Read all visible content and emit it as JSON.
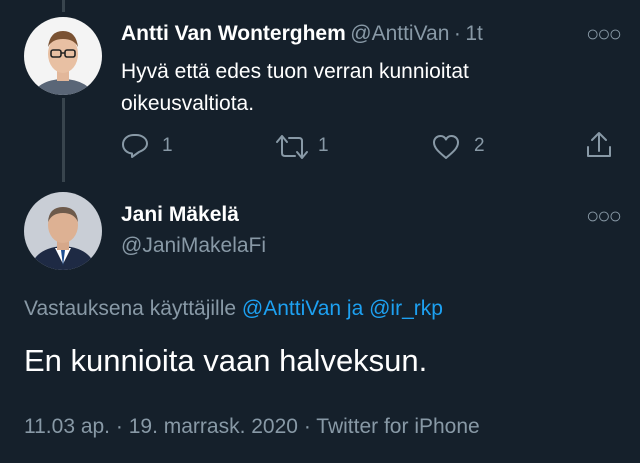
{
  "reply_tweet": {
    "author_name": "Antti Van Wonterghem",
    "author_handle": "@AnttiVan",
    "separator": "·",
    "time": "1t",
    "text_line1": "Hyvä että edes tuon verran kunnioitat",
    "text_line2": "oikeusvaltiota.",
    "reply_count": "1",
    "retweet_count": "1",
    "like_count": "2"
  },
  "main_tweet": {
    "author_name": "Jani Mäkelä",
    "author_handle": "@JaniMakelaFi",
    "reply_prefix": "Vastauksena käyttäjille",
    "mention1": "@AnttiVan",
    "conjunction": "ja",
    "mention2": "@ir_rkp",
    "text": "En kunnioita vaan halveksun.",
    "timestamp": "11.03 ap.",
    "date": "19. marrask. 2020",
    "source": "Twitter for iPhone",
    "meta_separator": "·"
  },
  "colors": {
    "background": "#15202b",
    "secondary_text": "#8899a6",
    "link": "#1da1f2",
    "thread_line": "#38444d"
  },
  "icons": [
    "reply-icon",
    "retweet-icon",
    "like-icon",
    "share-icon",
    "more-options-icon"
  ]
}
